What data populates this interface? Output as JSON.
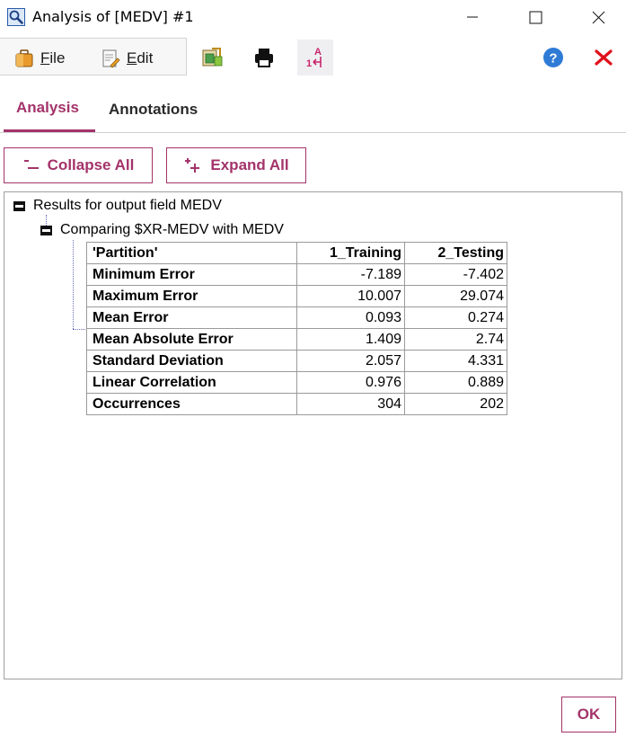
{
  "window": {
    "title": "Analysis of [MEDV] #1",
    "title_icon": "magnifier-icon"
  },
  "toolbar": {
    "file_label": "File",
    "file_mnemonic": "F",
    "file_rest": "ile",
    "edit_label": "Edit",
    "edit_mnemonic": "E",
    "edit_rest": "dit",
    "icons": [
      "export-icon",
      "print-icon",
      "sort-icon",
      "help-icon",
      "close-icon"
    ]
  },
  "tabs": [
    {
      "label": "Analysis",
      "active": true
    },
    {
      "label": "Annotations",
      "active": false
    }
  ],
  "actions": {
    "collapse_label": "Collapse All",
    "expand_label": "Expand All"
  },
  "tree": {
    "root_label": "Results for output field MEDV",
    "child_label": "Comparing $XR-MEDV with MEDV"
  },
  "table": {
    "columns": [
      "'Partition'",
      "1_Training",
      "2_Testing"
    ],
    "rows": [
      {
        "label": "Minimum Error",
        "training": "-7.189",
        "testing": "-7.402"
      },
      {
        "label": "Maximum Error",
        "training": "10.007",
        "testing": "29.074"
      },
      {
        "label": "Mean Error",
        "training": "0.093",
        "testing": "0.274"
      },
      {
        "label": "Mean Absolute Error",
        "training": "1.409",
        "testing": "2.74"
      },
      {
        "label": "Standard Deviation",
        "training": "2.057",
        "testing": "4.331"
      },
      {
        "label": "Linear Correlation",
        "training": "0.976",
        "testing": "0.889"
      },
      {
        "label": "Occurrences",
        "training": "304",
        "testing": "202"
      }
    ]
  },
  "footer": {
    "ok_label": "OK"
  },
  "colors": {
    "accent": "#a3336a",
    "help_blue": "#2e7bd6",
    "close_red": "#e0101a"
  }
}
